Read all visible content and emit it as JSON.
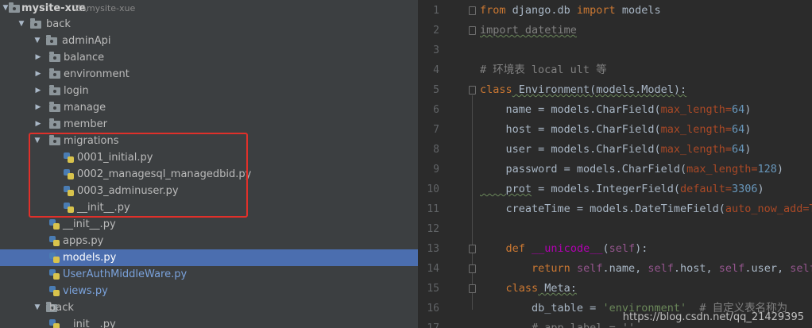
{
  "project": {
    "name": "mysite-xue",
    "path": "Z:\\mysite-xue"
  },
  "tree": {
    "back": "back",
    "adminApi": "adminApi",
    "balance": "balance",
    "environment": "environment",
    "login": "login",
    "manage": "manage",
    "member": "member",
    "migrations": "migrations",
    "mig_files": [
      "0001_initial.py",
      "0002_managesql_managedbid.py",
      "0003_adminuser.py",
      "__init__.py"
    ],
    "init_file": "__init__.py",
    "apps": "apps.py",
    "models": "models.py",
    "userauth": "UserAuthMiddleWare.py",
    "views": "views.py",
    "back2": "back",
    "init2": "__init__.py"
  },
  "line_numbers": [
    "1",
    "2",
    "3",
    "4",
    "5",
    "6",
    "7",
    "8",
    "9",
    "10",
    "11",
    "12",
    "13",
    "14",
    "15",
    "16",
    "17"
  ],
  "code": {
    "l1": [
      "from",
      " django.db ",
      "import",
      " models"
    ],
    "l2": "import datetime",
    "l4": "# 环境表 local ult 等",
    "l5": [
      "class",
      " Environment(models.Model):"
    ],
    "l6": [
      "    name = models.CharField(",
      "max_length",
      "=",
      "64",
      ")"
    ],
    "l7": [
      "    host = models.CharField(",
      "max_length",
      "=",
      "64",
      ")"
    ],
    "l8": [
      "    user = models.CharField(",
      "max_length",
      "=",
      "64",
      ")"
    ],
    "l9": [
      "    password = models.CharField(",
      "max_length",
      "=",
      "128",
      ")"
    ],
    "l10": [
      "    prot",
      " = models.IntegerField(",
      "default",
      "=",
      "3306",
      ")"
    ],
    "l11": [
      "    createTime = models.DateTimeField(",
      "auto_now_add",
      "=Tr"
    ],
    "l13": [
      "    ",
      "def",
      " ",
      "__unicode__",
      "(",
      "self",
      "):"
    ],
    "l14": [
      "        ",
      "return",
      " ",
      "self",
      ".name, ",
      "self",
      ".host, ",
      "self",
      ".user, ",
      "self",
      "."
    ],
    "l15": [
      "    ",
      "class",
      " Meta:"
    ],
    "l16": [
      "        db_table = ",
      "'environment'",
      "  ",
      "# 自定义表名称为"
    ],
    "l17": [
      "        ",
      "# app_label = ''"
    ]
  },
  "watermark": "https://blog.csdn.net/qq_21429395"
}
